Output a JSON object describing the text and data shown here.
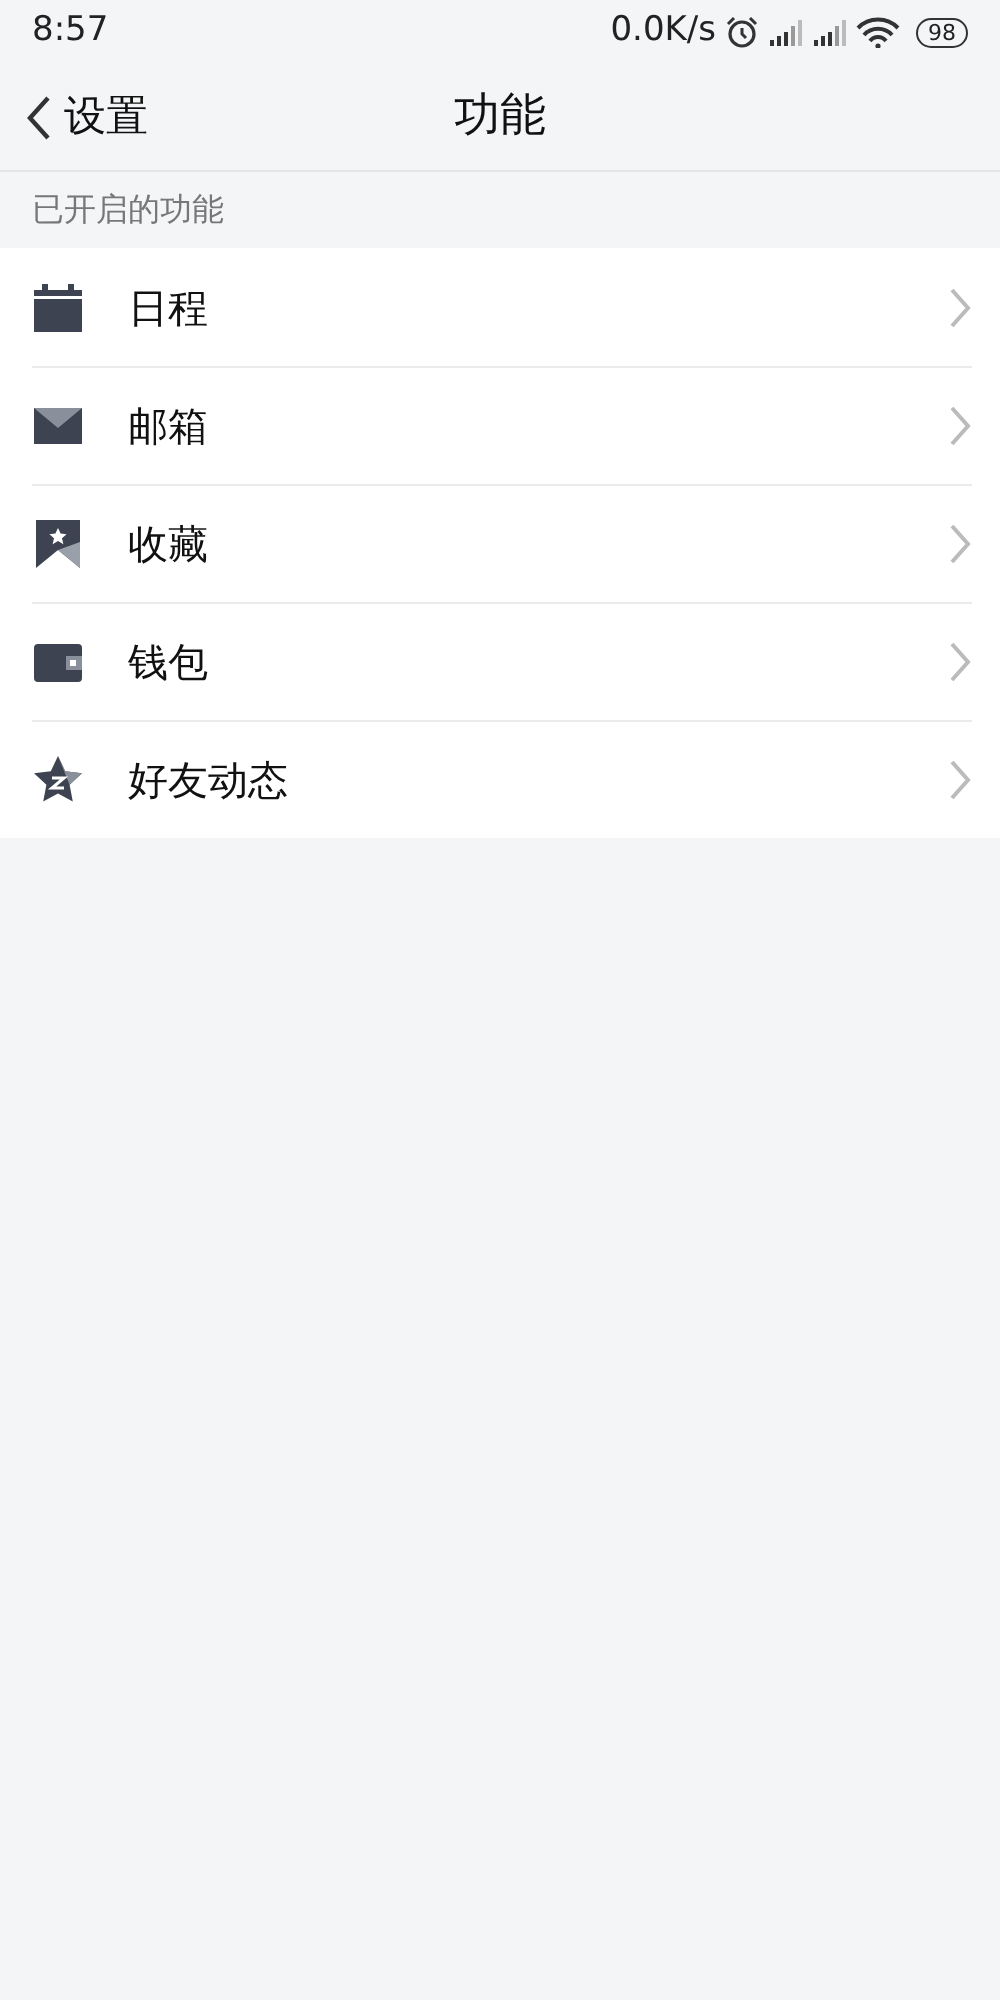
{
  "status_bar": {
    "time": "8:57",
    "speed": "0.0K/s",
    "battery": "98"
  },
  "nav": {
    "back_label": "设置",
    "title": "功能"
  },
  "section": {
    "title": "已开启的功能",
    "items": [
      {
        "kind": "calendar",
        "label": "日程"
      },
      {
        "kind": "mail",
        "label": "邮箱"
      },
      {
        "kind": "bookmark",
        "label": "收藏"
      },
      {
        "kind": "wallet",
        "label": "钱包"
      },
      {
        "kind": "star",
        "label": "好友动态"
      }
    ]
  }
}
